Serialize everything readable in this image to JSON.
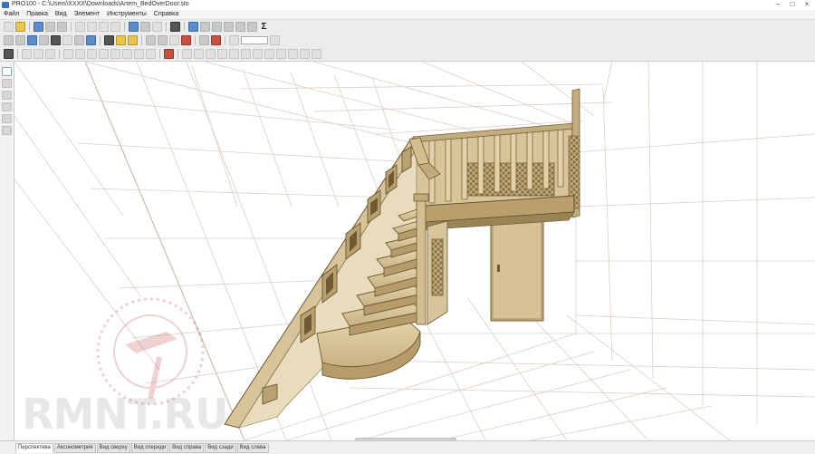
{
  "window": {
    "title": "PRO100 - C:\\Users\\XXXX\\Downloads\\Artem_BedOverDoor.sto",
    "buttons": [
      "–",
      "□",
      "×"
    ]
  },
  "menu": {
    "items": [
      "Файл",
      "Правка",
      "Вид",
      "Элемент",
      "Инструменты",
      "Справка"
    ]
  },
  "toolbar": {
    "sigma_label": "Σ"
  },
  "tabs": {
    "items": [
      "Перспектива",
      "Аксонометрия",
      "Вид сверху",
      "Вид спереди",
      "Вид справа",
      "Вид сзади",
      "Вид слева"
    ],
    "active_index": 0
  },
  "watermark": {
    "text": "RMNT.RU"
  },
  "colors": {
    "wood": "#d8c49a",
    "wood_dark": "#a8915f",
    "wood_edge": "#6f5a33",
    "grid": "#d9cbc0",
    "grid_strong": "#c7b2a3"
  }
}
